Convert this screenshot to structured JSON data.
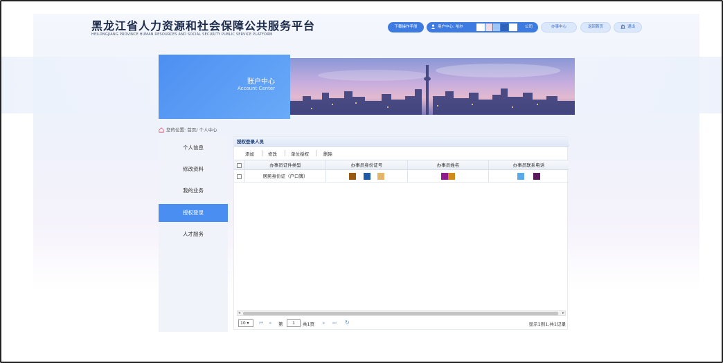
{
  "header": {
    "title": "黑龙江省人力资源和社会保障公共服务平台",
    "subtitle": "HEILONGJIANG PROVINCE HUMAN RESOURCES AND SOCIAL SECURITY PUBLIC SERVICE PLATFORM",
    "download_manual": "下载操作手册",
    "user_center_label": "用户中心: 哈尔",
    "company_suffix": "公司",
    "office_center": "办事中心",
    "back_home": "返回首页",
    "logout": "退出"
  },
  "banner": {
    "title_cn": "账户中心",
    "title_en": "Account Center"
  },
  "breadcrumb": {
    "text": "您的位置: 首页/ 个人中心"
  },
  "sidebar": {
    "items": [
      {
        "label": "个人信息",
        "active": false
      },
      {
        "label": "修改资料",
        "active": false
      },
      {
        "label": "我的业务",
        "active": false
      },
      {
        "label": "授权登录",
        "active": true
      },
      {
        "label": "人才服务",
        "active": false
      }
    ]
  },
  "panel": {
    "title": "授权登录人员",
    "toolbar": {
      "add": "添加",
      "edit": "修改",
      "unit_auth": "单位授权",
      "delete": "删除"
    },
    "columns": [
      "办事员证件类型",
      "办事员身份证号",
      "办事员姓名",
      "办事员联系电话"
    ],
    "rows": [
      {
        "id_type": "居民身份证（户口簿）",
        "id_number_swatches": [
          "#9b5a12",
          "#1f5aa6",
          "#e3b56a"
        ],
        "name_swatches": [
          "#8e1c8c",
          "#d08a1a"
        ],
        "phone_swatches": [
          "#5aa9e8",
          "#5c1a5e"
        ]
      }
    ]
  },
  "pager": {
    "page_size": "10",
    "page_label_pre": "第",
    "page_value": "1",
    "page_label_post": "共1页",
    "record_info": "显示1到1,共1记录"
  },
  "colors": {
    "accent": "#4a8ef2",
    "header_text": "#1c2a4a"
  }
}
